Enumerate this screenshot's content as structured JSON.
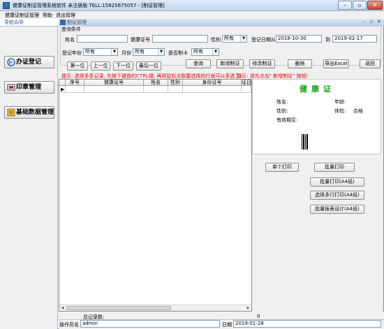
{
  "window": {
    "title": "健康证制证管理系统软件 未注册版 TELL:15825675057  - [制证管理]"
  },
  "menu": [
    "健康证制证管理",
    "帮助",
    "退出管理"
  ],
  "nav": {
    "header": "导航向导",
    "items": [
      {
        "label": "办证登记"
      },
      {
        "label": "印章管理"
      },
      {
        "label": "基础数据管理"
      }
    ]
  },
  "mdi": {
    "title": "制证管理"
  },
  "query": {
    "group_label": "查询条件",
    "name_label": "姓名",
    "name_value": "",
    "cert_label": "健康证号",
    "cert_value": "",
    "gender_label": "性别",
    "gender_value": "所有",
    "date_label": "登记日期从",
    "date_from": "2018-10-30",
    "date_to_label": "到",
    "date_to": "2019-02-17",
    "year_label": "登记年份",
    "year_value": "所有",
    "month_label": "月份",
    "month_value": "所有",
    "made_label": "是否制卡",
    "made_value": "所有"
  },
  "buttons": {
    "first": "第一位",
    "prev": "上一位",
    "next": "下一位",
    "last": "最后一位",
    "search": "查询",
    "new": "新增制证",
    "edit": "修改制证",
    "delete": "删除",
    "export": "导出Excel",
    "back": "返回"
  },
  "tips": {
    "left": "提示: 选择多条记录, 先按下键盘的CTRL键, 再用鼠标点取要选择的行就可以多选了!",
    "right": "提示: 请先点击\" 新增制证\" 按钮!"
  },
  "table": {
    "columns": [
      "序号",
      "健康证号",
      "姓名",
      "性别",
      "身份证号",
      "证日"
    ]
  },
  "card": {
    "title": "健康证",
    "name_label": "姓名:",
    "age_label": "年龄:",
    "gender_label": "性别:",
    "exam_label": "体检:",
    "exam_value": "合格",
    "valid_label": "有效期至:"
  },
  "print": {
    "single": "单个打印",
    "batch": "批量打印",
    "batch_a4": "批量打印(A4纸)",
    "multi_a4": "选择多行打印(A4纸)",
    "design_a4": "批量报表设计(A4纸)"
  },
  "footer": {
    "total_label": "总记录数:",
    "total_value": "0",
    "operator_label": "操作员名",
    "operator_value": "admin",
    "date_label": "日期",
    "date_value": "2019-01-28"
  },
  "colors": {
    "accent": "#1f5fa5",
    "tip_red": "#e00000",
    "card_green": "#1aa01a"
  }
}
